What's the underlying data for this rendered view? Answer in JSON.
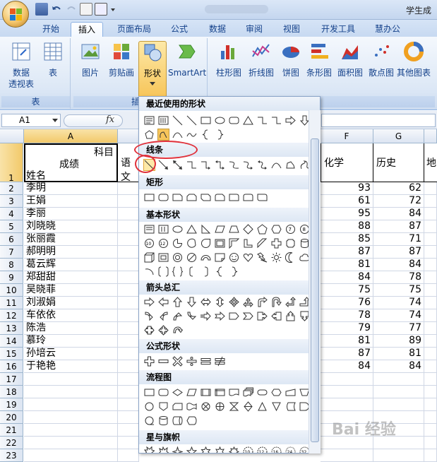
{
  "window": {
    "title": "学生成"
  },
  "tabs": [
    {
      "label": "开始",
      "active": false
    },
    {
      "label": "插入",
      "active": true
    },
    {
      "label": "页面布局",
      "active": false
    },
    {
      "label": "公式",
      "active": false
    },
    {
      "label": "数据",
      "active": false
    },
    {
      "label": "审阅",
      "active": false
    },
    {
      "label": "视图",
      "active": false
    },
    {
      "label": "开发工具",
      "active": false
    },
    {
      "label": "慧办公",
      "active": false
    }
  ],
  "ribbon": {
    "group_table_label": "表",
    "pivot_label": "数据\n透视表",
    "table_label": "表",
    "picture_label": "图片",
    "clipart_label": "剪贴画",
    "shapes_label": "形状",
    "smartart_label": "SmartArt",
    "column_chart_label": "柱形图",
    "line_chart_label": "折线图",
    "pie_chart_label": "饼图",
    "bar_chart_label": "条形图",
    "area_chart_label": "面积图",
    "scatter_chart_label": "散点图",
    "other_chart_label": "其他图表",
    "illus_group_partial": "插"
  },
  "formula_bar": {
    "cell_ref": "A1",
    "fx": "fx"
  },
  "sheet": {
    "columns": [
      "A",
      "F",
      "G"
    ],
    "header_cell": {
      "top_right": "科目",
      "middle": "成绩",
      "bottom_left": "姓名",
      "col_b": "语文",
      "col_f": "化学",
      "col_g": "历史",
      "col_h": "地"
    },
    "rows": [
      {
        "n": "2",
        "name": "李明",
        "f": "93",
        "g": "62"
      },
      {
        "n": "3",
        "name": "王娟",
        "f": "61",
        "g": "72"
      },
      {
        "n": "4",
        "name": "李丽",
        "f": "95",
        "g": "84"
      },
      {
        "n": "5",
        "name": "刘晓晓",
        "f": "88",
        "g": "87"
      },
      {
        "n": "6",
        "name": "张丽霞",
        "f": "85",
        "g": "71"
      },
      {
        "n": "7",
        "name": "郝明明",
        "f": "87",
        "g": "87"
      },
      {
        "n": "8",
        "name": "葛云辉",
        "f": "81",
        "g": "84"
      },
      {
        "n": "9",
        "name": "郑甜甜",
        "f": "84",
        "g": "78"
      },
      {
        "n": "10",
        "name": "吴晓菲",
        "f": "75",
        "g": "75"
      },
      {
        "n": "11",
        "name": "刘淑娟",
        "f": "76",
        "g": "74"
      },
      {
        "n": "12",
        "name": "车依依",
        "f": "78",
        "g": "74"
      },
      {
        "n": "13",
        "name": "陈浩",
        "f": "79",
        "g": "77"
      },
      {
        "n": "14",
        "name": "慕玲",
        "f": "81",
        "g": "89"
      },
      {
        "n": "15",
        "name": "孙培云",
        "f": "87",
        "g": "81"
      },
      {
        "n": "16",
        "name": "于艳艳",
        "f": "84",
        "g": "84"
      }
    ],
    "empty_rows": [
      "17",
      "18",
      "19",
      "20",
      "21",
      "22",
      "23"
    ]
  },
  "shapes_menu": {
    "sections": [
      "最近使用的形状",
      "线条",
      "矩形",
      "基本形状",
      "箭头总汇",
      "公式形状",
      "流程图",
      "星与旗帜"
    ]
  },
  "watermark": "Bai 经验",
  "colors": {
    "accent": "#15428b",
    "highlight_circle": "#e0303a",
    "selected_header": "#f2c96a"
  }
}
